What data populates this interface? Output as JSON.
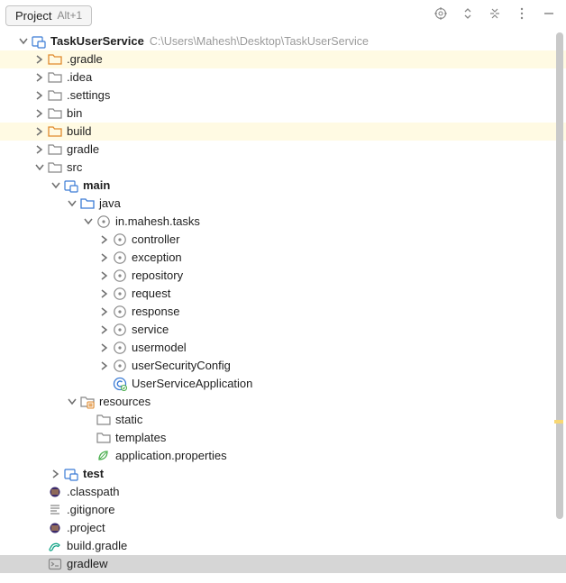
{
  "toolbar": {
    "tab_label": "Project",
    "tab_shortcut": "Alt+1"
  },
  "root": {
    "name": "TaskUserService",
    "path": "C:\\Users\\Mahesh\\Desktop\\TaskUserService"
  },
  "tree": {
    "gradle_hidden": ".gradle",
    "idea_hidden": ".idea",
    "settings_hidden": ".settings",
    "bin": "bin",
    "build": "build",
    "gradle": "gradle",
    "src": "src",
    "main": "main",
    "java": "java",
    "pkg": "in.mahesh.tasks",
    "controller": "controller",
    "exception": "exception",
    "repository": "repository",
    "request": "request",
    "response": "response",
    "service": "service",
    "usermodel": "usermodel",
    "userSecurityConfig": "userSecurityConfig",
    "userServiceApplication": "UserServiceApplication",
    "resources": "resources",
    "static": "static",
    "templates": "templates",
    "application_properties": "application.properties",
    "test": "test",
    "classpath": ".classpath",
    "gitignore": ".gitignore",
    "project_file": ".project",
    "build_gradle": "build.gradle",
    "gradlew": "gradlew"
  }
}
